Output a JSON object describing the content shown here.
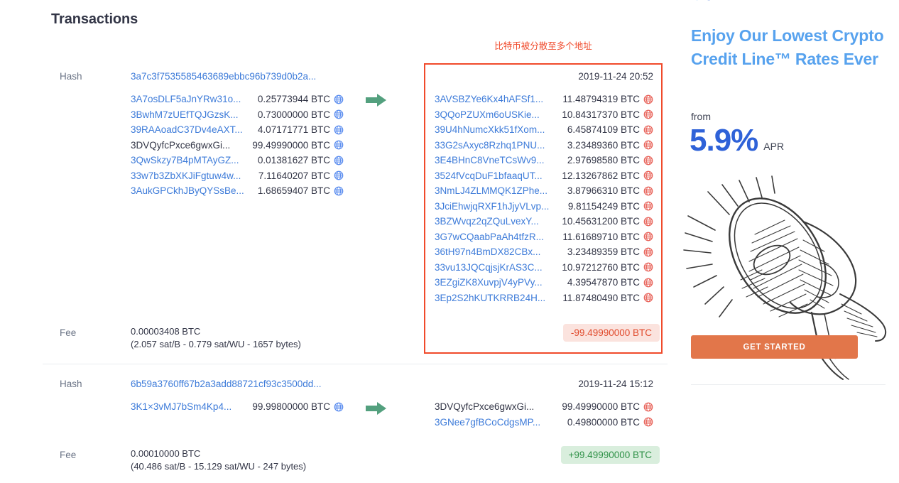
{
  "page_title": "Transactions",
  "annotation": {
    "text": "比特币被分散至多个地址",
    "color": "#f04a2b"
  },
  "labels": {
    "hash": "Hash",
    "fee": "Fee"
  },
  "icons": {
    "globe_in": "globe-blue-icon",
    "globe_out": "globe-red-icon",
    "arrow": "arrow-right-icon"
  },
  "colors": {
    "link": "#3d7bd9",
    "arrow_green": "#53a07e",
    "highlight_red": "#f04a2b",
    "badge_neg_bg": "#fbe3de",
    "badge_neg_fg": "#e0492b",
    "badge_pos_bg": "#d9eedd",
    "badge_pos_fg": "#2f9147"
  },
  "transactions": [
    {
      "hash": "3a7c3f7535585463689ebbc96b739d0b2a...",
      "time": "2019-11-24 20:52",
      "inputs": [
        {
          "address": "3A7osDLF5aJnYRw31o...",
          "amount": "0.25773944 BTC",
          "link": true
        },
        {
          "address": "3BwhM7zUEfTQJGzsK...",
          "amount": "0.73000000 BTC",
          "link": true
        },
        {
          "address": "39RAAoadC37Dv4eAXT...",
          "amount": "4.07171771 BTC",
          "link": true
        },
        {
          "address": "3DVQyfcPxce6gwxGi...",
          "amount": "99.49990000 BTC",
          "link": false
        },
        {
          "address": "3QwSkzy7B4pMTAyGZ...",
          "amount": "0.01381627 BTC",
          "link": true
        },
        {
          "address": "33w7b3ZbXKJiFgtuw4w...",
          "amount": "7.11640207 BTC",
          "link": true
        },
        {
          "address": "3AukGPCkhJByQYSsBe...",
          "amount": "1.68659407 BTC",
          "link": true
        }
      ],
      "outputs": [
        {
          "address": "3AVSBZYe6Kx4hAFSf1...",
          "amount": "11.48794319 BTC",
          "link": true
        },
        {
          "address": "3QQoPZUXm6oUSKie...",
          "amount": "10.84317370 BTC",
          "link": true
        },
        {
          "address": "39U4hNumcXkk51fXom...",
          "amount": "6.45874109 BTC",
          "link": true
        },
        {
          "address": "33G2sAxyc8Rzhq1PNU...",
          "amount": "3.23489360 BTC",
          "link": true
        },
        {
          "address": "3E4BHnC8VneTCsWv9...",
          "amount": "2.97698580 BTC",
          "link": true
        },
        {
          "address": "3524fVcqDuF1bfaaqUT...",
          "amount": "12.13267862 BTC",
          "link": true
        },
        {
          "address": "3NmLJ4ZLMMQK1ZPhe...",
          "amount": "3.87966310 BTC",
          "link": true
        },
        {
          "address": "3JciEhwjqRXF1hJjyVLvp...",
          "amount": "9.81154249 BTC",
          "link": true
        },
        {
          "address": "3BZWvqz2qZQuLvexY...",
          "amount": "10.45631200 BTC",
          "link": true
        },
        {
          "address": "3G7wCQaabPaAh4tfzR...",
          "amount": "11.61689710 BTC",
          "link": true
        },
        {
          "address": "36tH97n4BmDX82CBx...",
          "amount": "3.23489359 BTC",
          "link": true
        },
        {
          "address": "33vu13JQCqjsjKrAS3C...",
          "amount": "10.97212760 BTC",
          "link": true
        },
        {
          "address": "3EZgiZK8XuvpjV4yPVy...",
          "amount": "4.39547870 BTC",
          "link": true
        },
        {
          "address": "3Ep2S2hKUTKRRB24H...",
          "amount": "11.87480490 BTC",
          "link": true
        }
      ],
      "fee_amount": "0.00003408 BTC",
      "fee_detail": "(2.057 sat/B - 0.779 sat/WU - 1657 bytes)",
      "balance_badge": "-99.49990000 BTC",
      "balance_sign": "negative"
    },
    {
      "hash": "6b59a3760ff67b2a3add88721cf93c3500dd...",
      "time": "2019-11-24 15:12",
      "inputs": [
        {
          "address": "3K1×3vMJ7bSm4Kp4...",
          "amount": "99.99800000 BTC",
          "link": true
        }
      ],
      "outputs": [
        {
          "address": "3DVQyfcPxce6gwxGi...",
          "amount": "99.49990000 BTC",
          "link": false
        },
        {
          "address": "3GNee7gfBCoCdgsMP...",
          "amount": "0.49800000 BTC",
          "link": true
        }
      ],
      "fee_amount": "0.00010000 BTC",
      "fee_detail": "(40.486 sat/B - 15.129 sat/WU - 247 bytes)",
      "balance_badge": "+99.49990000 BTC",
      "balance_sign": "positive"
    }
  ],
  "ad": {
    "headline": "Enjoy Our Lowest Crypto Credit Line™ Rates Ever",
    "from_label": "from",
    "rate": "5.9%",
    "apr_label": "APR",
    "cta": "GET STARTED"
  }
}
